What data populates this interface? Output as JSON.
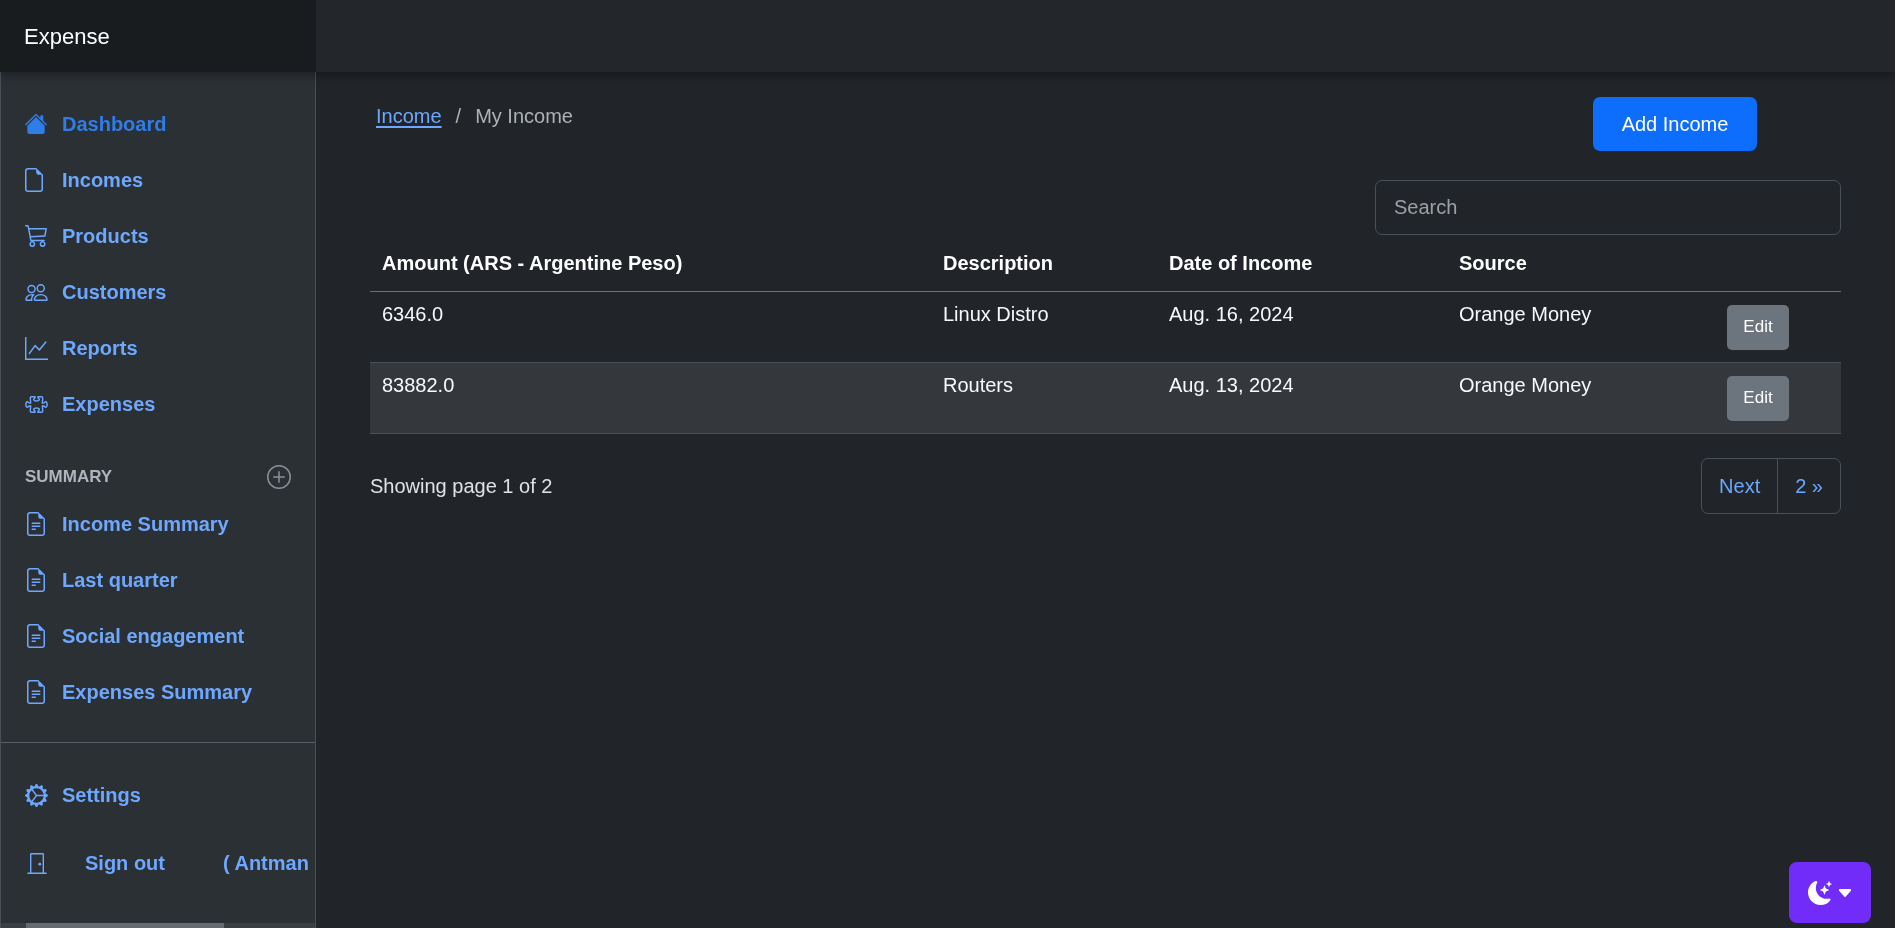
{
  "brand": "Expense",
  "sidebar": {
    "nav": [
      {
        "label": "Dashboard",
        "selected": true
      },
      {
        "label": "Incomes",
        "selected": false
      },
      {
        "label": "Products",
        "selected": false
      },
      {
        "label": "Customers",
        "selected": false
      },
      {
        "label": "Reports",
        "selected": false
      },
      {
        "label": "Expenses",
        "selected": false
      }
    ],
    "summary": {
      "heading": "SUMMARY",
      "items": [
        {
          "label": "Income Summary",
          "selected": false
        },
        {
          "label": "Last quarter",
          "selected": false
        },
        {
          "label": "Social engagement",
          "selected": false
        },
        {
          "label": "Expenses Summary",
          "selected": false
        }
      ]
    },
    "settings": {
      "label": "Settings"
    },
    "sign_out": {
      "label": "Sign out",
      "user": "( Antman"
    }
  },
  "breadcrumb": {
    "items": [
      {
        "label": "Income",
        "active": false
      },
      {
        "label": "My Income",
        "active": true
      }
    ],
    "separator": "/"
  },
  "add_button": {
    "label": "Add Income"
  },
  "search": {
    "placeholder": "Search"
  },
  "table": {
    "columns": [
      "Amount (ARS - Argentine Peso)",
      "Description",
      "Date of Income",
      "Source"
    ],
    "rows": [
      {
        "cells": [
          "6346.0",
          "Linux Distro",
          "Aug. 16, 2024",
          "Orange Money"
        ],
        "action": "Edit",
        "highlighted": false
      },
      {
        "cells": [
          "83882.0",
          "Routers",
          "Aug. 13, 2024",
          "Orange Money"
        ],
        "action": "Edit",
        "highlighted": true
      }
    ]
  },
  "pagination": {
    "status": "Showing page 1 of 2",
    "links": [
      "Next",
      "2 »"
    ]
  }
}
